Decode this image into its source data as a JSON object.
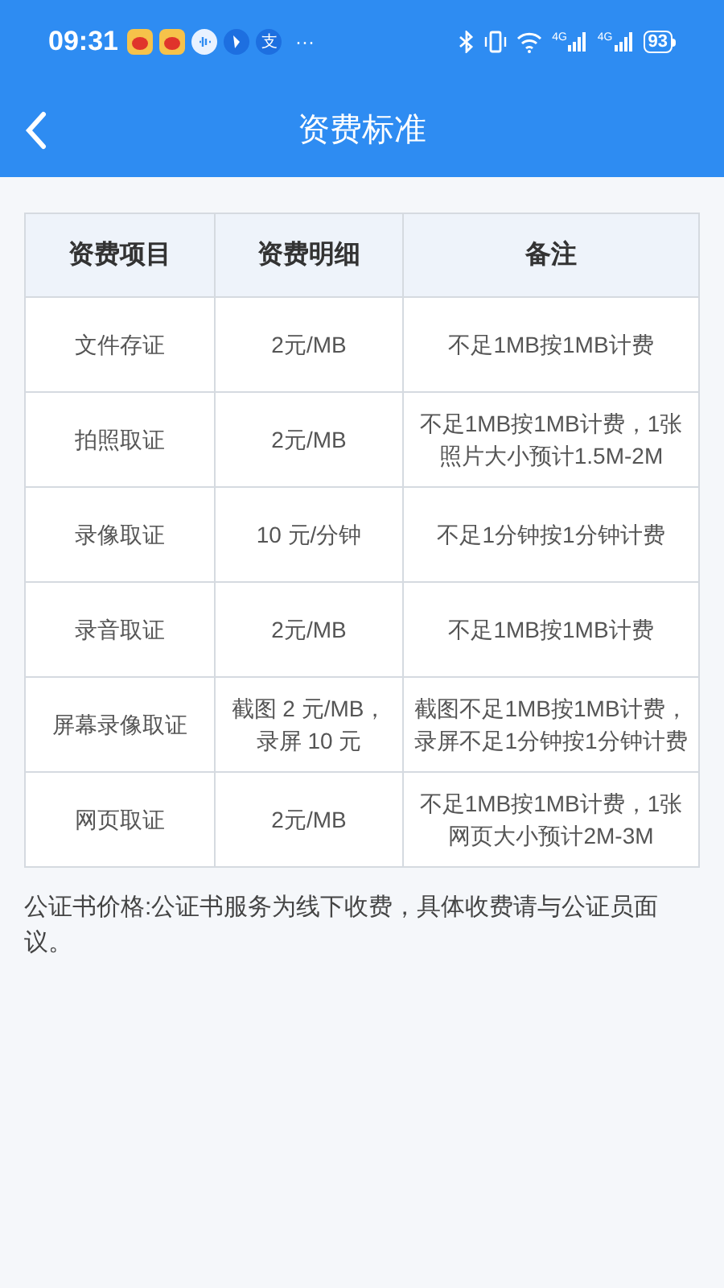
{
  "status_bar": {
    "time": "09:31",
    "app_glyph": "支",
    "more": "···",
    "network_labels": [
      "4G",
      "4G"
    ],
    "battery": "93"
  },
  "header": {
    "title": "资费标准"
  },
  "table": {
    "columns": [
      "资费项目",
      "资费明细",
      "备注"
    ],
    "rows": [
      [
        "文件存证",
        "2元/MB",
        "不足1MB按1MB计费"
      ],
      [
        "拍照取证",
        "2元/MB",
        "不足1MB按1MB计费，1张照片大小预计1.5M-2M"
      ],
      [
        "录像取证",
        "10 元/分钟",
        "不足1分钟按1分钟计费"
      ],
      [
        "录音取证",
        "2元/MB",
        "不足1MB按1MB计费"
      ],
      [
        "屏幕录像取证",
        "截图 2 元/MB，录屏 10 元",
        "截图不足1MB按1MB计费，录屏不足1分钟按1分钟计费"
      ],
      [
        "网页取证",
        "2元/MB",
        "不足1MB按1MB计费，1张网页大小预计2M-3M"
      ]
    ]
  },
  "note": "公证书价格:公证书服务为线下收费，具体收费请与公证员面议。"
}
